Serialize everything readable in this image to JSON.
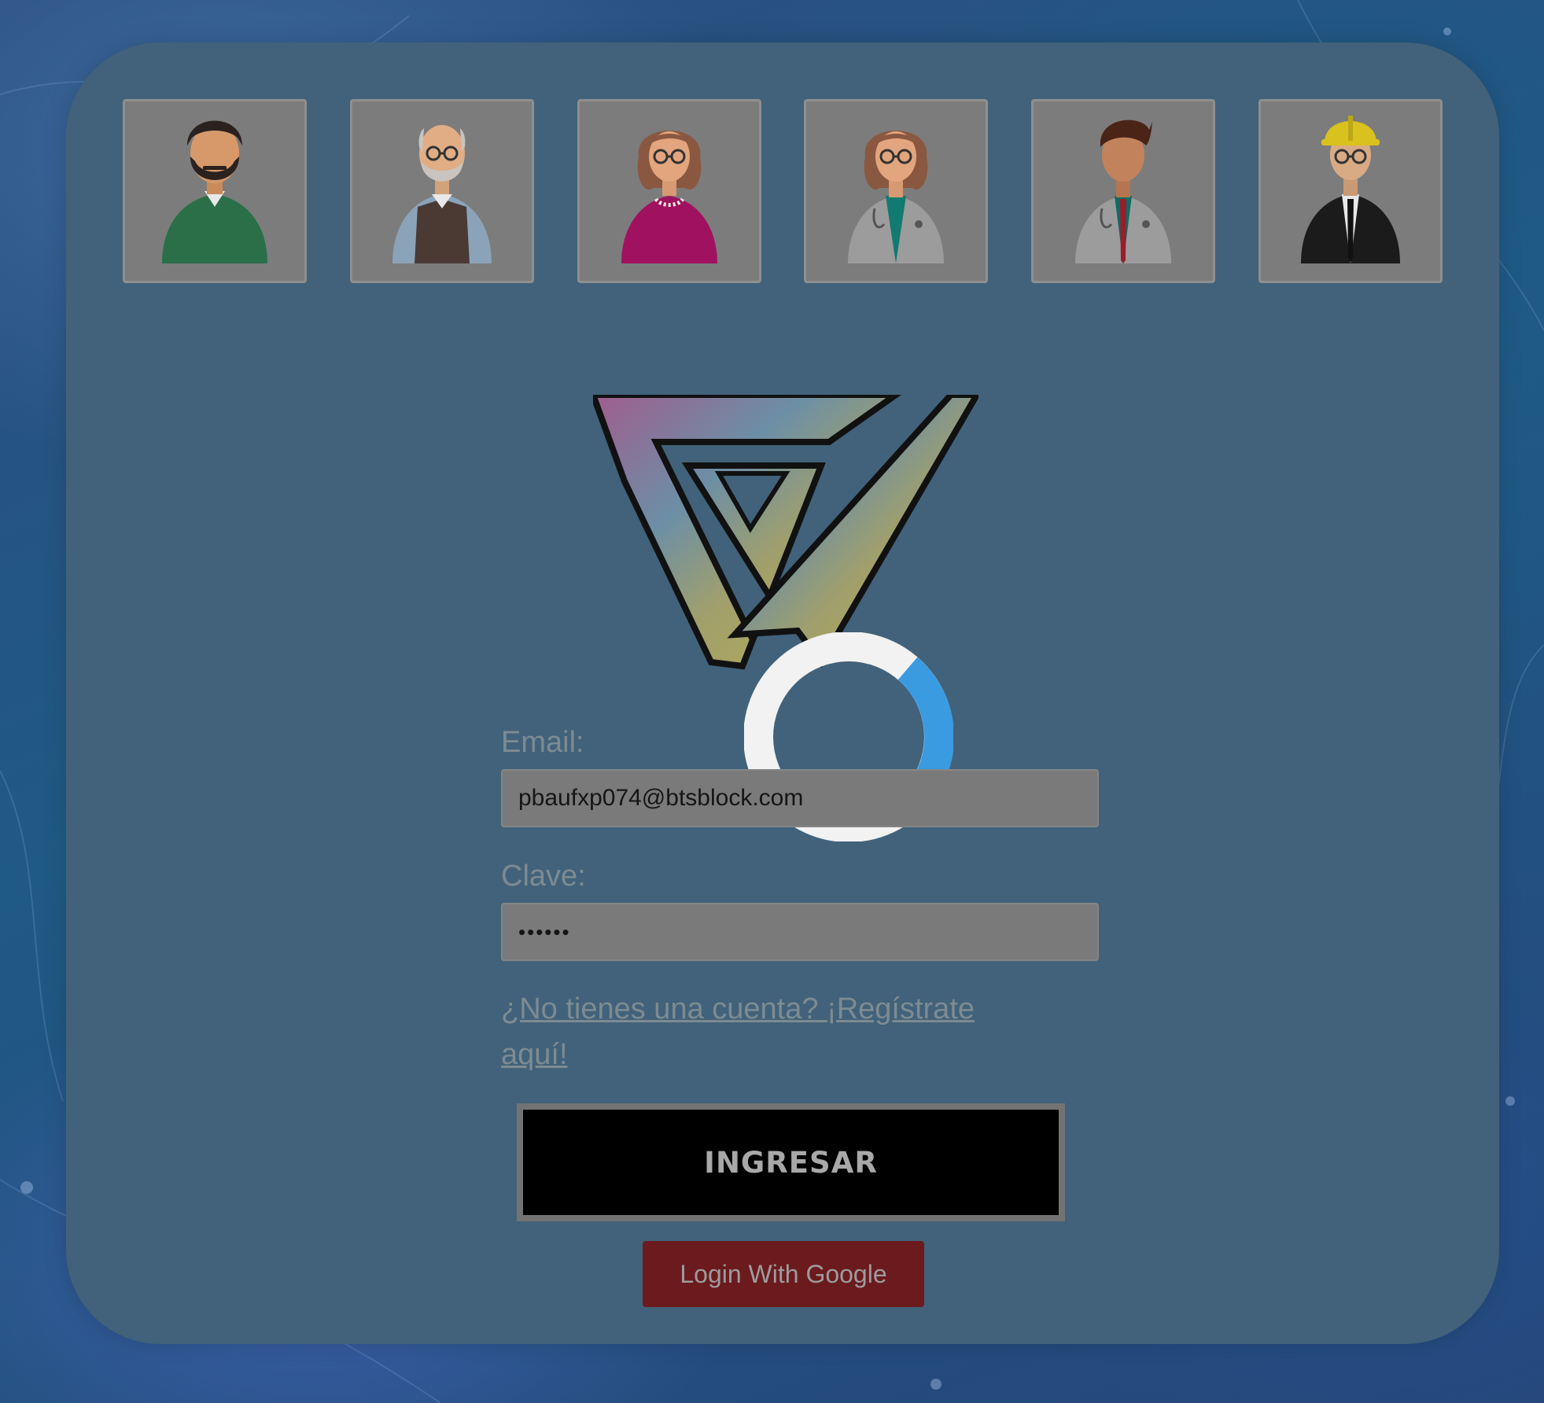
{
  "avatars": [
    {
      "name": "bearded-man-green-sweater"
    },
    {
      "name": "old-man-vest"
    },
    {
      "name": "woman-pink-top"
    },
    {
      "name": "female-doctor"
    },
    {
      "name": "male-doctor"
    },
    {
      "name": "engineer-hard-hat"
    }
  ],
  "form": {
    "email_label": "Email:",
    "email_value": "pbaufxp074@btsblock.com",
    "password_label": "Clave:",
    "password_value": "••••••",
    "register_link": "¿No tienes una cuenta? ¡Regístrate aquí!"
  },
  "buttons": {
    "ingresar": "INGRESAR",
    "google": "Login With Google"
  },
  "colors": {
    "card": "#41627a",
    "spinner_track": "#f2f2f2",
    "spinner_arc": "#3a9be0",
    "google_button": "#6b1a1e"
  }
}
